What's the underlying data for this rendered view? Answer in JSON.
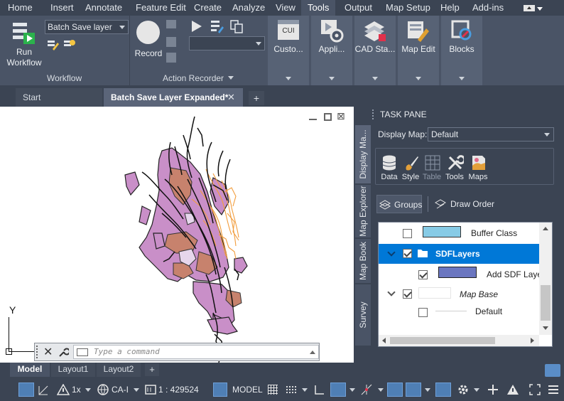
{
  "menubar": {
    "items": [
      "Home",
      "Insert",
      "Annotate",
      "Feature Edit",
      "Create",
      "Analyze",
      "View",
      "Tools",
      "Output",
      "Map Setup",
      "Help",
      "Add-ins"
    ],
    "active": "Tools"
  },
  "ribbon": {
    "workflow": {
      "run_label_1": "Run",
      "run_label_2": "Workflow",
      "combo_value": "Batch Save layer",
      "panel_label": "Workflow"
    },
    "action_recorder": {
      "record_label": "Record",
      "panel_label": "Action Recorder"
    },
    "buttons": [
      {
        "label": "Custo...",
        "icon": "cui-icon"
      },
      {
        "label": "Appli...",
        "icon": "applications-gear-icon"
      },
      {
        "label": "CAD Sta...",
        "icon": "cad-standards-icon"
      },
      {
        "label": "Map Edit",
        "icon": "map-edit-icon"
      },
      {
        "label": "Blocks",
        "icon": "blocks-icon"
      }
    ],
    "cui_text": "CUI"
  },
  "doc_tabs": {
    "start": "Start",
    "active": "Batch Save Layer Expanded*"
  },
  "canvas": {
    "ucs_y": "Y",
    "command_placeholder": "Type a command"
  },
  "task_pane": {
    "title": "TASK PANE",
    "display_map_label": "Display Map:",
    "display_map_value": "Default",
    "side_tabs": [
      "Display Ma...",
      "Map Explorer",
      "Map Book",
      "Survey"
    ],
    "toolbar": [
      {
        "label": "Data",
        "icon": "data-icon"
      },
      {
        "label": "Style",
        "icon": "style-brush-icon"
      },
      {
        "label": "Table",
        "icon": "table-icon"
      },
      {
        "label": "Tools",
        "icon": "tools-icon"
      },
      {
        "label": "Maps",
        "icon": "maps-icon"
      }
    ],
    "groups_label": "Groups",
    "draw_order_label": "Draw Order",
    "layers": [
      {
        "name": "Buffer Class",
        "checked": false,
        "swatch": "#87cbe6"
      },
      {
        "name": "SDFLayers",
        "checked": true,
        "group": true
      },
      {
        "name": "Add SDF Layer",
        "checked": true,
        "swatch": "#6b76c0"
      },
      {
        "name": "Map Base",
        "checked": true
      },
      {
        "name": "Default",
        "checked": false
      }
    ]
  },
  "layout_tabs": [
    "Model",
    "Layout1",
    "Layout2"
  ],
  "status": {
    "scale_mult": "1x",
    "coord_sys": "CA-I",
    "scale": "1 : 429524",
    "model": "MODEL"
  },
  "colors": {
    "accent": "#0078d7",
    "polygon": "#c98fc8",
    "orange": "#f29d3d",
    "dark_panel": "#3b4453"
  }
}
